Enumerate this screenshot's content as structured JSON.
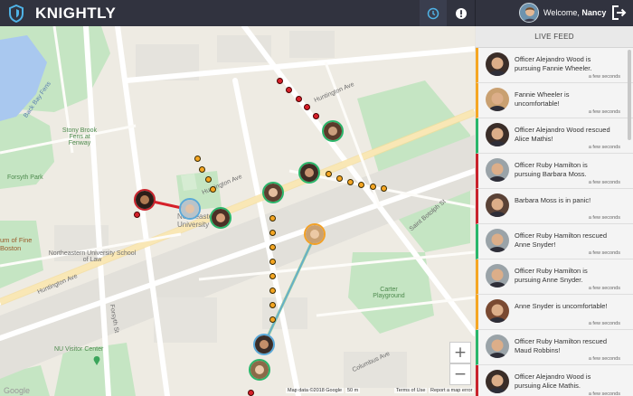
{
  "app": {
    "title": "KNIGHTLY"
  },
  "user": {
    "welcome": "Welcome,",
    "name": "Nancy"
  },
  "feed": {
    "header": "LIVE FEED",
    "items": [
      {
        "text": "Officer Alejandro Wood is pursuing Fannie Wheeler.",
        "time": "a few seconds",
        "status": "orange",
        "avatar": "#3a2d28"
      },
      {
        "text": "Fannie Wheeler is uncomfortable!",
        "time": "a few seconds",
        "status": "orange",
        "avatar": "#c9a071"
      },
      {
        "text": "Officer Alejandro Wood rescued Alice Mathis!",
        "time": "a few seconds",
        "status": "green",
        "avatar": "#3a2d28"
      },
      {
        "text": "Officer Ruby Hamilton is pursuing Barbara Moss.",
        "time": "a few seconds",
        "status": "red",
        "avatar": "#9aa3a8"
      },
      {
        "text": "Barbara Moss is in panic!",
        "time": "a few seconds",
        "status": "red",
        "avatar": "#5a4236"
      },
      {
        "text": "Officer Ruby Hamilton rescued Anne Snyder!",
        "time": "a few seconds",
        "status": "green",
        "avatar": "#9aa3a8"
      },
      {
        "text": "Officer Ruby Hamilton is pursuing Anne Snyder.",
        "time": "a few seconds",
        "status": "orange",
        "avatar": "#9aa3a8"
      },
      {
        "text": "Anne Snyder is uncomfortable!",
        "time": "a few seconds",
        "status": "orange",
        "avatar": "#7a4a32"
      },
      {
        "text": "Officer Ruby Hamilton rescued Maud Robbins!",
        "time": "a few seconds",
        "status": "green",
        "avatar": "#9aa3a8"
      },
      {
        "text": "Officer Alejandro Wood is pursuing Alice Mathis.",
        "time": "a few seconds",
        "status": "red",
        "avatar": "#3a2d28"
      }
    ]
  },
  "map": {
    "labels": [
      {
        "text": "Back Bay Fens",
        "cls": "blue"
      },
      {
        "text": "Huntington Ave",
        "cls": ""
      },
      {
        "text": "Huntington Ave",
        "cls": ""
      },
      {
        "text": "Huntington Ave",
        "cls": ""
      },
      {
        "text": "Northeastern University",
        "cls": ""
      },
      {
        "text": "Northeastern University School of Law",
        "cls": ""
      },
      {
        "text": "NU Visitor Center",
        "cls": "green"
      },
      {
        "text": "Forsyth Park",
        "cls": "green"
      },
      {
        "text": "Stony Brook Fens at Fenway",
        "cls": "green"
      },
      {
        "text": "Carter Playground",
        "cls": "green"
      },
      {
        "text": "Saint Botolph St",
        "cls": ""
      },
      {
        "text": "Columbus Ave",
        "cls": ""
      },
      {
        "text": "Forsyth St",
        "cls": ""
      },
      {
        "text": "um of Fine Boston",
        "cls": ""
      }
    ],
    "attribution": {
      "data": "Map data ©2018 Google",
      "scale": "50 m",
      "terms": "Terms of Use",
      "report": "Report a map error"
    },
    "google": "Google",
    "zoom_in": "+",
    "zoom_out": "−"
  }
}
